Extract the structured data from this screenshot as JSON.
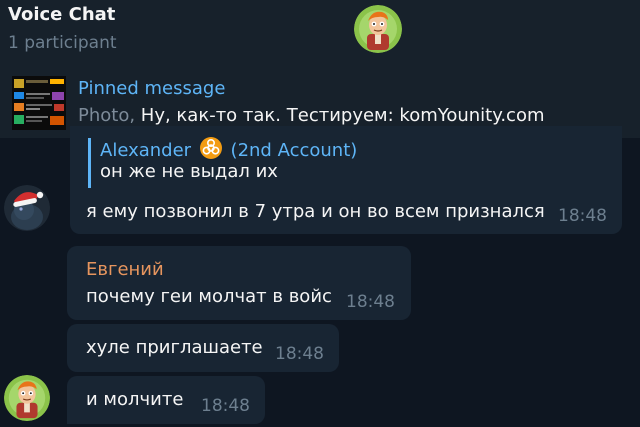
{
  "header": {
    "title": "Voice Chat",
    "subtitle": "1 participant",
    "avatar_icon": "fry-avatar-icon"
  },
  "pinned": {
    "label": "Pinned message",
    "prefix": "Photo,",
    "text": " Ну, как-то так. Тестируем: komYounity.com"
  },
  "messages": [
    {
      "reply_name": "Alexander",
      "reply_name_suffix": "(2nd Account)",
      "reply_badge_icon": "biohazard-icon",
      "reply_text": "он же не выдал их",
      "text": "я ему позвонил  в 7 утра и он во всем признался",
      "time": "18:48",
      "avatar_icon": "santa-hat-avatar-icon"
    },
    {
      "sender": "Евгений",
      "text": "почему геи молчат в войс",
      "time": "18:48"
    },
    {
      "text": "хуле приглашаете",
      "time": "18:48"
    },
    {
      "text": "и молчите",
      "time": "18:48",
      "avatar_icon": "fry-avatar-icon"
    }
  ],
  "colors": {
    "background": "#0e1621",
    "header": "#17212b",
    "bubble": "#182533",
    "accent_blue": "#5eb5f7",
    "sender_orange": "#e6955e",
    "muted": "#6d7f8f"
  }
}
